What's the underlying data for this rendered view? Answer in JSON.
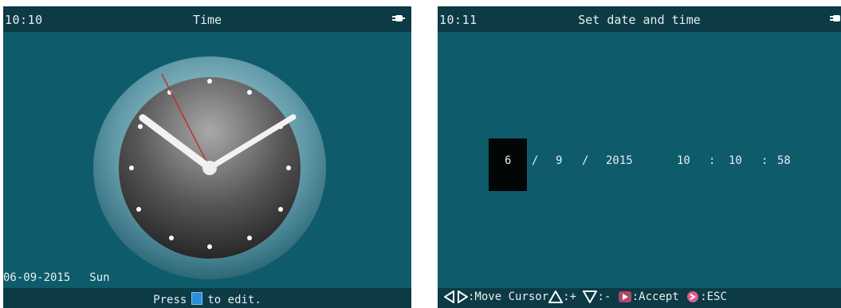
{
  "left_screen": {
    "status_time": "10:10",
    "title": "Time",
    "date": "06-09-2015",
    "weekday": "Sun",
    "hint_press": "Press",
    "hint_edit": "to edit."
  },
  "right_screen": {
    "status_time": "10:11",
    "title": "Set date and time",
    "fields": {
      "day": "6",
      "sep1": "/",
      "month": "9",
      "sep2": "/",
      "year": "2015",
      "hour": "10",
      "colon1": ":",
      "minute": "10",
      "colon2": ":",
      "second": "58"
    },
    "key_hints": {
      "move_cursor": ":Move Cursor",
      "plus": ":+",
      "minus": ":-",
      "accept": ":Accept",
      "esc": ":ESC"
    }
  },
  "colors": {
    "screen_bg": "#0e5b6b",
    "bar_bg": "#0c3a45",
    "text": "#e8eef0",
    "second_hand": "#c0302a"
  },
  "icons": [
    "power-plug-icon",
    "edit-key-icon",
    "left-right-arrows-icon",
    "up-triangle-icon",
    "down-triangle-icon",
    "accept-play-icon",
    "esc-back-icon"
  ]
}
